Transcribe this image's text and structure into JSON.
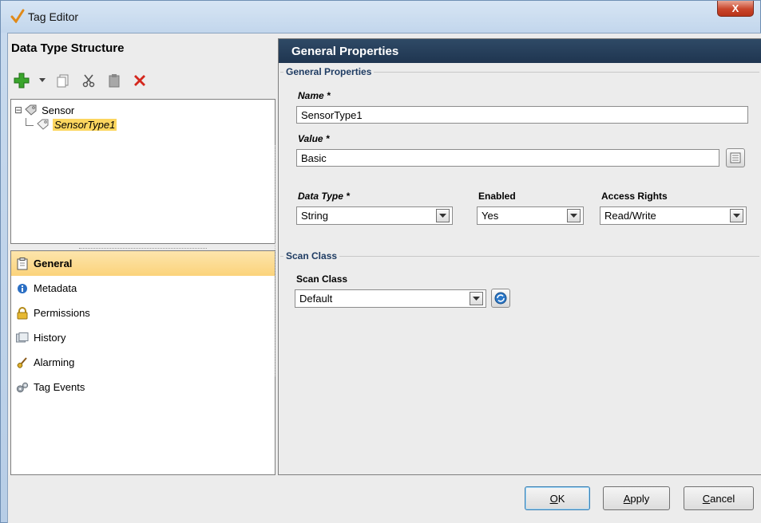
{
  "window": {
    "title": "Tag Editor",
    "close_label": "X"
  },
  "left": {
    "title": "Data Type Structure",
    "toolbar": [
      "add-icon",
      "dropdown-arrow-icon",
      "copy-icon",
      "cut-icon",
      "paste-icon",
      "delete-icon"
    ],
    "tree": [
      {
        "label": "Sensor",
        "expander": "⊟"
      },
      {
        "label": "SensorType1"
      }
    ],
    "nav": [
      {
        "label": "General",
        "icon": "general-icon",
        "active": true
      },
      {
        "label": "Metadata",
        "icon": "info-icon"
      },
      {
        "label": "Permissions",
        "icon": "lock-icon"
      },
      {
        "label": "History",
        "icon": "history-icon"
      },
      {
        "label": "Alarming",
        "icon": "bell-icon"
      },
      {
        "label": "Tag Events",
        "icon": "gears-icon"
      }
    ]
  },
  "right": {
    "header": "General Properties",
    "general_group": "General Properties",
    "name_label": "Name *",
    "name_value": "SensorType1",
    "value_label": "Value *",
    "value_value": "Basic",
    "datatype_label": "Data Type *",
    "datatype_value": "String",
    "enabled_label": "Enabled",
    "enabled_value": "Yes",
    "access_label": "Access Rights",
    "access_value": "Read/Write",
    "scan_group": "Scan Class",
    "scan_label": "Scan Class",
    "scan_value": "Default"
  },
  "buttons": {
    "ok_hotkey": "O",
    "ok_rest": "K",
    "apply_hotkey": "A",
    "apply_rest": "pply",
    "cancel_hotkey": "C",
    "cancel_rest": "ancel"
  },
  "colors": {
    "header_bg": "#1f3550",
    "active_nav": "#fbd37b",
    "group_title": "#1f3c63"
  }
}
